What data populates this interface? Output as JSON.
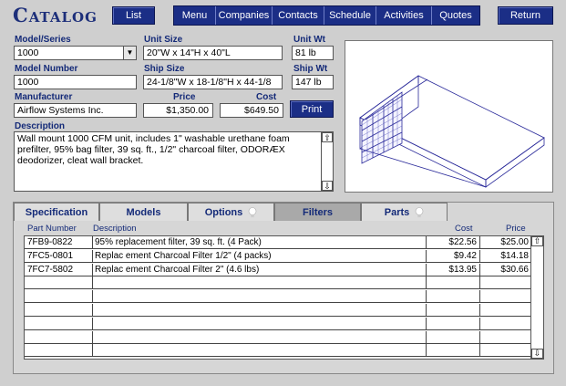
{
  "header": {
    "logo": "Catalog",
    "list_label": "List",
    "nav": [
      "Menu",
      "Companies",
      "Contacts",
      "Schedule",
      "Activities",
      "Quotes"
    ],
    "return_label": "Return"
  },
  "form": {
    "model_series": {
      "label": "Model/Series",
      "value": "1000"
    },
    "unit_size": {
      "label": "Unit Size",
      "value": "20\"W x 14\"H x 40\"L"
    },
    "unit_wt": {
      "label": "Unit Wt",
      "value": "81 lb"
    },
    "model_number": {
      "label": "Model Number",
      "value": "1000"
    },
    "ship_size": {
      "label": "Ship Size",
      "value": "24-1/8\"W x 18-1/8\"H x 44-1/8"
    },
    "ship_wt": {
      "label": "Ship Wt",
      "value": "147 lb"
    },
    "manufacturer": {
      "label": "Manufacturer",
      "value": "Airflow Systems Inc."
    },
    "price": {
      "label": "Price",
      "value": "$1,350.00"
    },
    "cost": {
      "label": "Cost",
      "value": "$649.50"
    },
    "print_label": "Print",
    "description": {
      "label": "Description",
      "value": "Wall mount 1000 CFM unit, includes 1\" washable urethane foam prefilter, 95% bag filter, 39 sq. ft., 1/2\" charcoal filter, ODORÆX deodorizer, cleat wall bracket."
    }
  },
  "tabs": [
    {
      "label": "Specification",
      "bulb": false,
      "active": false
    },
    {
      "label": "Models",
      "bulb": false,
      "active": false
    },
    {
      "label": "Options",
      "bulb": true,
      "active": false
    },
    {
      "label": "Filters",
      "bulb": false,
      "active": true
    },
    {
      "label": "Parts",
      "bulb": true,
      "active": false
    }
  ],
  "table": {
    "columns": [
      "Part Number",
      "Description",
      "Cost",
      "Price"
    ],
    "rows": [
      {
        "part": "7FB9-0822",
        "desc": "95% replacement filter, 39 sq. ft. (4 Pack)",
        "cost": "$22.56",
        "price": "$25.00"
      },
      {
        "part": "7FC5-0801",
        "desc": "Replac ement Charcoal Filter 1/2\" (4 packs)",
        "cost": "$9.42",
        "price": "$14.18"
      },
      {
        "part": "7FC7-5802",
        "desc": "Replac ement Charcoal Filter 2\" (4.6 lbs)",
        "cost": "$13.95",
        "price": "$30.66"
      }
    ],
    "empty_rows": 6
  },
  "colors": {
    "accent": "#1b2e86",
    "label": "#142a78",
    "background": "#cfcfcf"
  },
  "icons": {
    "scroll_up": "up-arrow-icon",
    "scroll_down": "down-arrow-icon",
    "dropdown": "chevron-down-icon",
    "tab_bulb": "lightbulb-icon"
  }
}
